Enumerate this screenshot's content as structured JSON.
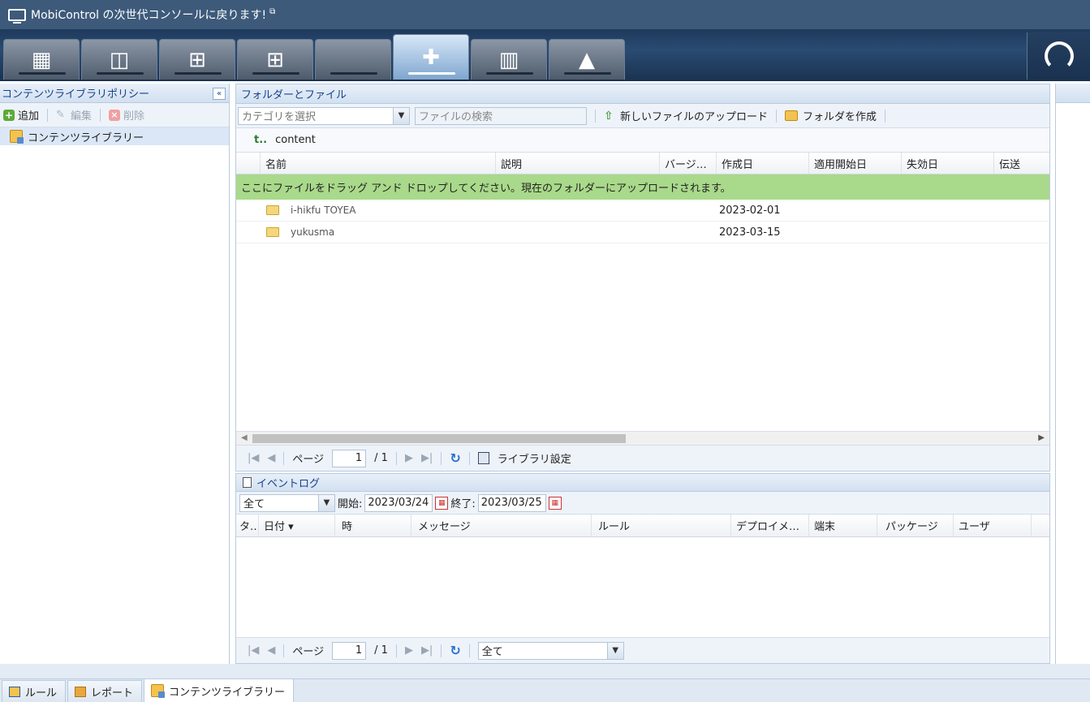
{
  "topbar": {
    "title": "MobiControl の次世代コンソールに戻ります!",
    "ext_icon": "⧉"
  },
  "nav": {
    "tabs": [
      {
        "icon": "apps-grid-icon",
        "glyph": "▦"
      },
      {
        "icon": "windows-mobile-icon",
        "glyph": "◫"
      },
      {
        "icon": "windows-desktop-icon",
        "glyph": "⊞"
      },
      {
        "icon": "windows-icon",
        "glyph": "⊞"
      },
      {
        "icon": "apple-icon",
        "glyph": ""
      },
      {
        "icon": "android-plus-icon",
        "glyph": "✚"
      },
      {
        "icon": "device-icon",
        "glyph": "▥"
      },
      {
        "icon": "linux-icon",
        "glyph": "▲"
      }
    ],
    "active_index": 5
  },
  "left": {
    "title": "コンテンツライブラリポリシー",
    "collapse": "«",
    "add": "追加",
    "edit": "編集",
    "delete": "削除",
    "tree_item": "コンテンツライブラリー"
  },
  "files": {
    "title": "フォルダーとファイル",
    "category_placeholder": "カテゴリを選択",
    "search_placeholder": "ファイルの検索",
    "upload": "新しいファイルのアップロード",
    "create_folder": "フォルダを作成",
    "up_symbol": "t..",
    "path": "content",
    "columns": [
      "名前",
      "説明",
      "バージ…",
      "作成日",
      "適用開始日",
      "失効日",
      "伝送"
    ],
    "drop_text": "ここにファイルをドラッグ アンド ドロップしてください。現在のフォルダーにアップロードされます。",
    "rows": [
      {
        "name": "i-hikfu TOYEA",
        "created": "2023-02-01"
      },
      {
        "name": "yukusma",
        "created": "2023-03-15"
      }
    ],
    "pager": {
      "page_label": "ページ",
      "page": "1",
      "total": "/ 1",
      "lib_settings": "ライブラリ設定"
    }
  },
  "events": {
    "title": "イベントログ",
    "filter": "全て",
    "start_label": "開始:",
    "start": "2023/03/24",
    "end_label": "終了:",
    "end": "2023/03/25",
    "columns": [
      "タ…",
      "日付 ▾",
      "時",
      "メッセージ",
      "ルール",
      "デプロイメ…",
      "端末",
      "パッケージ",
      "ユーザ"
    ],
    "pager": {
      "page_label": "ページ",
      "page": "1",
      "total": "/ 1",
      "filter": "全て"
    }
  },
  "bottom_tabs": [
    "ルール",
    "レポート",
    "コンテンツライブラリー"
  ]
}
